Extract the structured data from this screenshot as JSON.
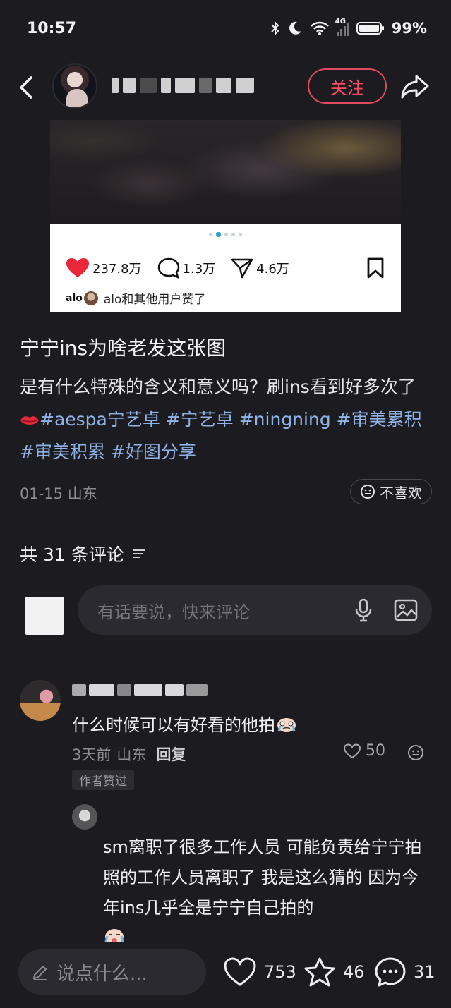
{
  "status_bar": {
    "time": "10:57",
    "network": "4G",
    "battery": "99%"
  },
  "header": {
    "username": "",
    "follow_label": "关注"
  },
  "post_image": {
    "likes": "237.8万",
    "comments": "1.3万",
    "shares": "4.6万",
    "liked_by_avatar_text": "alo",
    "liked_by": "alo和其他用户赞了",
    "carousel_dots": 5,
    "carousel_active": 2
  },
  "post": {
    "title": "宁宁ins为啥老发这张图",
    "body_text": "是有什么特殊的含义和意义吗？刷ins看到好多次了",
    "tags": [
      "#aespa宁艺卓",
      "#宁艺卓",
      "#ningning",
      "#审美累积",
      "#审美积累",
      "#好图分享"
    ],
    "date_location": "01-15 山东",
    "dislike_label": "不喜欢"
  },
  "comments_section": {
    "count_label": "共 31 条评论",
    "input_placeholder": "有话要说，快来评论"
  },
  "comments": [
    {
      "text": "什么时候可以有好看的他拍",
      "time": "3天前",
      "location": "山东",
      "reply_label": "回复",
      "likes": "50",
      "badge": "作者赞过"
    }
  ],
  "reply": {
    "name": "",
    "text": "sm离职了很多工作人员 可能负责给宁宁拍照的工作人员离职了 我是这么猜的 因为今年ins几乎全是宁宁自己拍的"
  },
  "bottom_bar": {
    "input_placeholder": "说点什么...",
    "likes": "753",
    "favorites": "46",
    "comments": "31"
  },
  "colors": {
    "background": "#1c1b20",
    "accent_red": "#ff4d63",
    "tag_blue": "#8fb3e6",
    "heart_red": "#e8283a"
  }
}
